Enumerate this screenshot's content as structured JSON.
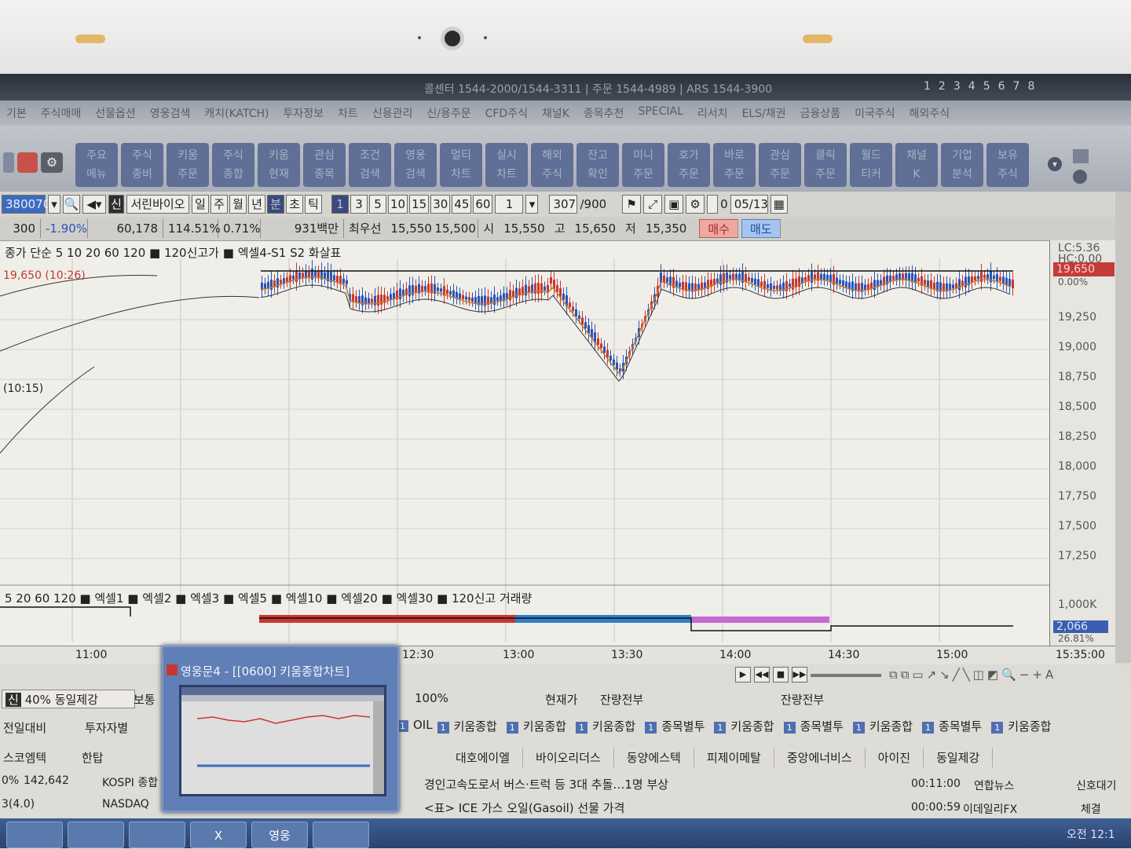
{
  "window": {
    "title_info": "콜센터 1544-2000/1544-3311 | 주문 1544-4989 | ARS 1544-3900",
    "screen_numbers": [
      "1",
      "2",
      "3",
      "4",
      "5",
      "6",
      "7",
      "8"
    ]
  },
  "menu": [
    "기본",
    "주식매매",
    "선물옵션",
    "영웅검색",
    "캐치(KATCH)",
    "투자정보",
    "차트",
    "신용관리",
    "신/용주문",
    "CFD주식",
    "채널K",
    "종목추천",
    "SPECIAL",
    "리서치",
    "ELS/채권",
    "금융상품",
    "미국주식",
    "해외주식"
  ],
  "toolbar": [
    {
      "label": "주요\n메뉴"
    },
    {
      "label": "주식\n종비"
    },
    {
      "label": "키움\n주문"
    },
    {
      "label": "주식\n종합"
    },
    {
      "label": "키움\n현재"
    },
    {
      "label": "관심\n종목"
    },
    {
      "label": "조건\n검색"
    },
    {
      "label": "영웅\n검색"
    },
    {
      "label": "멀티\n차트"
    },
    {
      "label": "실시\n차트"
    },
    {
      "label": "해외\n주식"
    },
    {
      "label": "잔고\n확인"
    },
    {
      "label": "미니\n주문"
    },
    {
      "label": "호가\n주문"
    },
    {
      "label": "바로\n주문"
    },
    {
      "label": "관심\n주문"
    },
    {
      "label": "클릭\n주문"
    },
    {
      "label": "월드\n티커"
    },
    {
      "label": "채널\nK"
    },
    {
      "label": "기업\n분석"
    },
    {
      "label": "보유\n주식"
    }
  ],
  "controls": {
    "code": "380070",
    "stock_badge": "신",
    "stock_name": "서린바이오",
    "periods": [
      "일",
      "주",
      "월",
      "년",
      "분",
      "초",
      "틱"
    ],
    "intervals": [
      "1",
      "3",
      "5",
      "10",
      "15",
      "30",
      "45",
      "60"
    ],
    "count_select": "1",
    "count": "307",
    "count_max": "/900",
    "date": "05/13",
    "checkbox_value": "0"
  },
  "quote": {
    "change": "300",
    "change_pct": "-1.90%",
    "volume": "60,178",
    "ratio": "114.51%",
    "turnover": "0.71%",
    "amount": "931백만",
    "best_label": "최우선",
    "best_ask": "15,550",
    "best_bid": "15,500",
    "open_label": "시",
    "open": "15,550",
    "high_label": "고",
    "high": "15,650",
    "low_label": "저",
    "low": "15,350",
    "buy_label": "매수",
    "sell_label": "매도"
  },
  "chart_legend": "종가 단순 5 10 20 60 120 ■ 120신고가 ■ 엑셀4-S1 S2 화살표",
  "chart_annotations": {
    "high_marker": "19,650 (10:26)",
    "low_marker": "(10:15)"
  },
  "volume_legend": "5 20 60 120 ■ 엑셀1 ■ 엑셀2 ■ 엑셀3 ■ 엑셀5 ■ 엑셀10 ■ 엑셀20 ■ 엑셀30 ■ 120신고 거래량",
  "axis": {
    "top_labels": [
      "LC:5.36",
      "HC:0.00"
    ],
    "current_price": "19,650",
    "current_pct": "0.00%",
    "ticks": [
      "19,250",
      "19,000",
      "18,750",
      "18,500",
      "18,250",
      "18,000",
      "17,750",
      "17,500",
      "17,250"
    ],
    "volume_top": "1,000K",
    "volume_current": "2,066",
    "volume_pct": "26.81%"
  },
  "time_axis": [
    "11:00",
    "12:30",
    "13:00",
    "13:30",
    "14:00",
    "14:30",
    "15:00",
    "15:35:00"
  ],
  "popup": {
    "title": "영웅문4 - [[0600] 키움종합차트]"
  },
  "lower": {
    "badge": "신",
    "margin": "40% 동일제강",
    "mode": "보통",
    "pct": "100%",
    "current_price_label": "현재가",
    "remain_label": "잔량전부",
    "remain_label2": "잔량전부",
    "left_tabs": [
      "전일대비",
      "투자자별"
    ],
    "tabs": [
      "키움종합",
      "키움종합",
      "키움종합",
      "종목별투",
      "키움종합",
      "종목별투",
      "키움종합",
      "종목별투",
      "키움종합"
    ],
    "tab_prefix": "OIL",
    "left_items": [
      "스코엠텍",
      "한탑"
    ],
    "stocks": [
      "대호에이엘",
      "바이오리더스",
      "동양에스텍",
      "피제이메탈",
      "중앙에너비스",
      "아이진",
      "동일제강"
    ],
    "index_rows": [
      {
        "pct": "0%",
        "value": "142,642",
        "name": "KOSPI 종합"
      },
      {
        "pct": "3(4.0)",
        "value": "",
        "name": "NASDAQ"
      }
    ],
    "news": [
      {
        "headline": "경인고속도로서 버스·트럭 등 3대 추돌…1명 부상",
        "time": "00:11:00",
        "source": "연합뉴스"
      },
      {
        "headline": "<표> ICE 가스 오일(Gasoil) 선물 가격",
        "time": "00:00:59",
        "source": "이데일리FX"
      }
    ],
    "right_labels": [
      "신호대기",
      "체결"
    ]
  },
  "taskbar": [
    "",
    "",
    "",
    "X",
    "영웅",
    ""
  ],
  "clock": "오전 12:1",
  "colors": {
    "up": "#c8372f",
    "down": "#2a55b8",
    "ma_orange": "#c9782a",
    "ma_dark": "#333333"
  }
}
